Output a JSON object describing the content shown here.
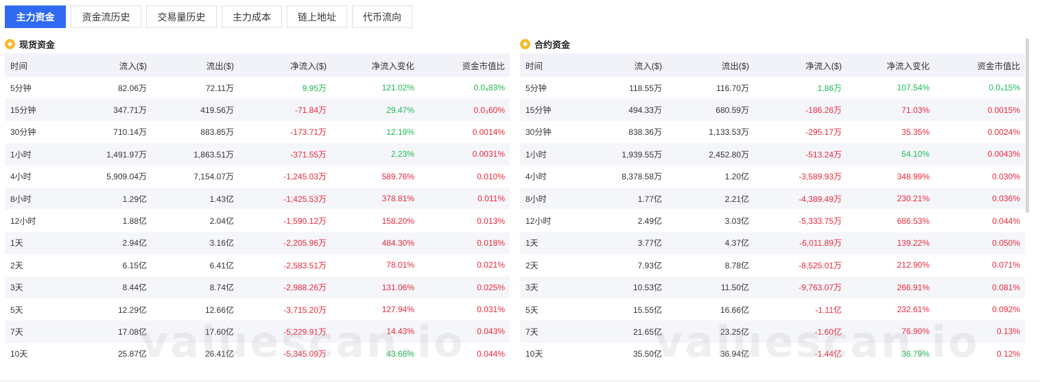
{
  "tabs": [
    {
      "label": "主力资金",
      "active": true
    },
    {
      "label": "资金流历史",
      "active": false
    },
    {
      "label": "交易量历史",
      "active": false
    },
    {
      "label": "主力成本",
      "active": false
    },
    {
      "label": "链上地址",
      "active": false
    },
    {
      "label": "代币流向",
      "active": false
    }
  ],
  "headers": [
    "时间",
    "流入($)",
    "流出($)",
    "净流入($)",
    "净流入变化",
    "资金市值比"
  ],
  "spot": {
    "title": "现货资金",
    "rows": [
      [
        "5分钟",
        "82.06万",
        "72.11万",
        "9.95万",
        "121.02%",
        "0.0₄83%"
      ],
      [
        "15分钟",
        "347.71万",
        "419.56万",
        "-71.84万",
        "29.47%",
        "0.0₃60%"
      ],
      [
        "30分钟",
        "710.14万",
        "883.85万",
        "-173.71万",
        "12.19%",
        "0.0014%"
      ],
      [
        "1小时",
        "1,491.97万",
        "1,863.51万",
        "-371.55万",
        "2.23%",
        "0.0031%"
      ],
      [
        "4小时",
        "5,909.04万",
        "7,154.07万",
        "-1,245.03万",
        "589.76%",
        "0.010%"
      ],
      [
        "8小时",
        "1.29亿",
        "1.43亿",
        "-1,425.53万",
        "378.81%",
        "0.011%"
      ],
      [
        "12小时",
        "1.88亿",
        "2.04亿",
        "-1,590.12万",
        "158.20%",
        "0.013%"
      ],
      [
        "1天",
        "2.94亿",
        "3.16亿",
        "-2,205.96万",
        "484.30%",
        "0.018%"
      ],
      [
        "2天",
        "6.15亿",
        "6.41亿",
        "-2,583.51万",
        "78.01%",
        "0.021%"
      ],
      [
        "3天",
        "8.44亿",
        "8.74亿",
        "-2,988.26万",
        "131.06%",
        "0.025%"
      ],
      [
        "5天",
        "12.29亿",
        "12.66亿",
        "-3,715.20万",
        "127.94%",
        "0.031%"
      ],
      [
        "7天",
        "17.08亿",
        "17.60亿",
        "-5,229.91万",
        "14.43%",
        "0.043%"
      ],
      [
        "10天",
        "25.87亿",
        "26.41亿",
        "-5,345.09万",
        "43.66%",
        "0.044%"
      ]
    ],
    "colors": [
      [
        "pos",
        "pos",
        "pos"
      ],
      [
        "neg",
        "pos",
        "neg"
      ],
      [
        "neg",
        "pos",
        "neg"
      ],
      [
        "neg",
        "pos",
        "neg"
      ],
      [
        "neg",
        "neg",
        "neg"
      ],
      [
        "neg",
        "neg",
        "neg"
      ],
      [
        "neg",
        "neg",
        "neg"
      ],
      [
        "neg",
        "neg",
        "neg"
      ],
      [
        "neg",
        "neg",
        "neg"
      ],
      [
        "neg",
        "neg",
        "neg"
      ],
      [
        "neg",
        "neg",
        "neg"
      ],
      [
        "neg",
        "neg",
        "neg"
      ],
      [
        "neg",
        "pos",
        "neg"
      ]
    ]
  },
  "contract": {
    "title": "合约资金",
    "rows": [
      [
        "5分钟",
        "118.55万",
        "116.70万",
        "1.86万",
        "107.54%",
        "0.0₄15%"
      ],
      [
        "15分钟",
        "494.33万",
        "680.59万",
        "-186.26万",
        "71.03%",
        "0.0015%"
      ],
      [
        "30分钟",
        "838.36万",
        "1,133.53万",
        "-295.17万",
        "35.35%",
        "0.0024%"
      ],
      [
        "1小时",
        "1,939.55万",
        "2,452.80万",
        "-513.24万",
        "54.10%",
        "0.0043%"
      ],
      [
        "4小时",
        "8,378.58万",
        "1.20亿",
        "-3,589.93万",
        "348.99%",
        "0.030%"
      ],
      [
        "8小时",
        "1.77亿",
        "2.21亿",
        "-4,389.49万",
        "230.21%",
        "0.036%"
      ],
      [
        "12小时",
        "2.49亿",
        "3.03亿",
        "-5,333.75万",
        "686.53%",
        "0.044%"
      ],
      [
        "1天",
        "3.77亿",
        "4.37亿",
        "-6,011.89万",
        "139.22%",
        "0.050%"
      ],
      [
        "2天",
        "7.93亿",
        "8.78亿",
        "-8,525.01万",
        "212.90%",
        "0.071%"
      ],
      [
        "3天",
        "10.53亿",
        "11.50亿",
        "-9,763.07万",
        "266.91%",
        "0.081%"
      ],
      [
        "5天",
        "15.55亿",
        "16.66亿",
        "-1.11亿",
        "232.61%",
        "0.092%"
      ],
      [
        "7天",
        "21.65亿",
        "23.25亿",
        "-1.60亿",
        "76.90%",
        "0.13%"
      ],
      [
        "10天",
        "35.50亿",
        "36.94亿",
        "-1.44亿",
        "36.79%",
        "0.12%"
      ]
    ],
    "colors": [
      [
        "pos",
        "pos",
        "pos"
      ],
      [
        "neg",
        "neg",
        "neg"
      ],
      [
        "neg",
        "neg",
        "neg"
      ],
      [
        "neg",
        "pos",
        "neg"
      ],
      [
        "neg",
        "neg",
        "neg"
      ],
      [
        "neg",
        "neg",
        "neg"
      ],
      [
        "neg",
        "neg",
        "neg"
      ],
      [
        "neg",
        "neg",
        "neg"
      ],
      [
        "neg",
        "neg",
        "neg"
      ],
      [
        "neg",
        "neg",
        "neg"
      ],
      [
        "neg",
        "neg",
        "neg"
      ],
      [
        "neg",
        "neg",
        "neg"
      ],
      [
        "neg",
        "pos",
        "neg"
      ]
    ]
  },
  "watermark": "valuescan.io",
  "theme": {
    "accent": "#2f6bf2",
    "positive": "#1ab94f",
    "negative": "#e8283a",
    "coin": "#f3ba2f"
  }
}
